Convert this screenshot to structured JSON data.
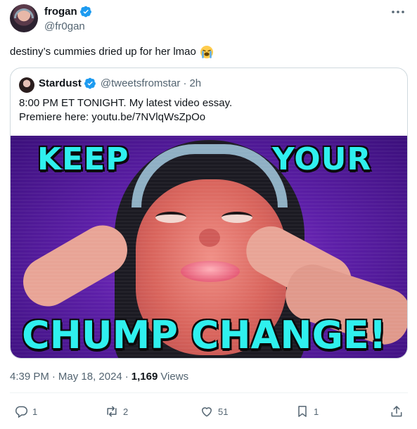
{
  "author": {
    "display_name": "frogan",
    "handle": "@fr0gan",
    "verified": true
  },
  "tweet": {
    "text": "destiny’s cummies dried up for her lmao",
    "emoji": "loudly-crying-face"
  },
  "quoted_tweet": {
    "display_name": "Stardust",
    "handle": "@tweetsfromstar",
    "separator": "·",
    "time": "2h",
    "line1": "8:00 PM ET TONIGHT. My latest video essay.",
    "line2": "Premiere here: youtu.be/7NVlqWsZpOo",
    "thumbnail": {
      "caption_top_left": "KEEP",
      "caption_top_right": "YOUR",
      "caption_bottom": "CHUMP CHANGE!"
    }
  },
  "meta": {
    "time": "4:39 PM",
    "dot1": "·",
    "date": "May 18, 2024",
    "dot2": "·",
    "views_count": "1,169",
    "views_label": "Views"
  },
  "actions": {
    "replies": "1",
    "reposts": "2",
    "likes": "51",
    "bookmarks": "1"
  },
  "colors": {
    "verified_badge": "#1d9bf0",
    "secondary_text": "#536471",
    "border": "#cfd9de",
    "caption": "#2ff0ee"
  },
  "icons": [
    "more-icon",
    "verified-icon",
    "reply-icon",
    "repost-icon",
    "like-icon",
    "bookmark-icon",
    "share-icon"
  ]
}
